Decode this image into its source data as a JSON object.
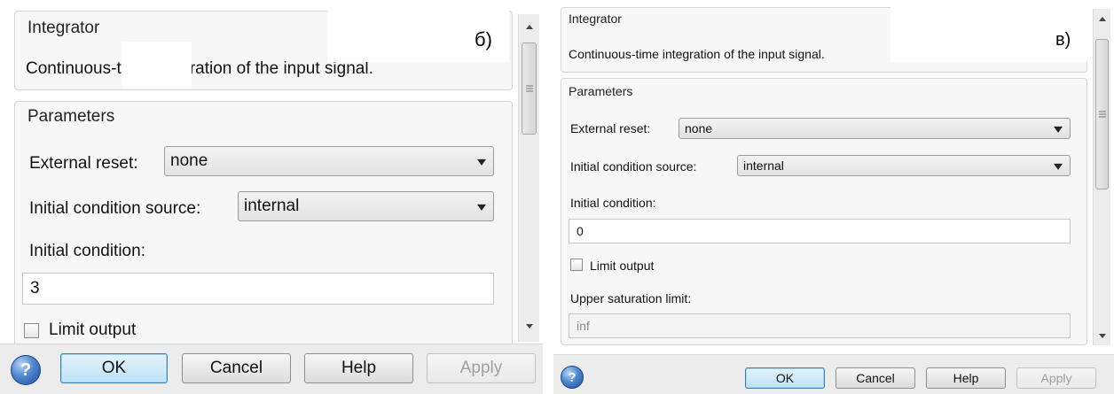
{
  "panel_b": {
    "tag": "б)",
    "block_title": "Integrator",
    "description": "Continuous-time integration of the input signal.",
    "params_title": "Parameters",
    "external_reset_label": "External reset:",
    "external_reset_value": "none",
    "ic_source_label": "Initial condition source:",
    "ic_source_value": "internal",
    "ic_label": "Initial condition:",
    "ic_value": "3",
    "limit_output_label": "Limit output",
    "buttons": {
      "ok": "OK",
      "cancel": "Cancel",
      "help": "Help",
      "apply": "Apply"
    }
  },
  "panel_v": {
    "tag": "в)",
    "block_title": "Integrator",
    "description": "Continuous-time integration of the input signal.",
    "params_title": "Parameters",
    "external_reset_label": "External reset:",
    "external_reset_value": "none",
    "ic_source_label": "Initial condition source:",
    "ic_source_value": "internal",
    "ic_label": "Initial condition:",
    "ic_value": "0",
    "limit_output_label": "Limit output",
    "upper_sat_label": "Upper saturation limit:",
    "upper_sat_value": "inf",
    "buttons": {
      "ok": "OK",
      "cancel": "Cancel",
      "help": "Help",
      "apply": "Apply"
    }
  },
  "icons": {
    "help": "help-question-icon",
    "scroll_up": "scroll-up-arrow-icon",
    "scroll_down": "scroll-down-arrow-icon",
    "dropdown": "chevron-down-icon"
  },
  "help_glyph": "?",
  "colors": {
    "default_button": "#bde2f6",
    "help_icon": "#4f86cf",
    "background": "#f7f7f7"
  }
}
